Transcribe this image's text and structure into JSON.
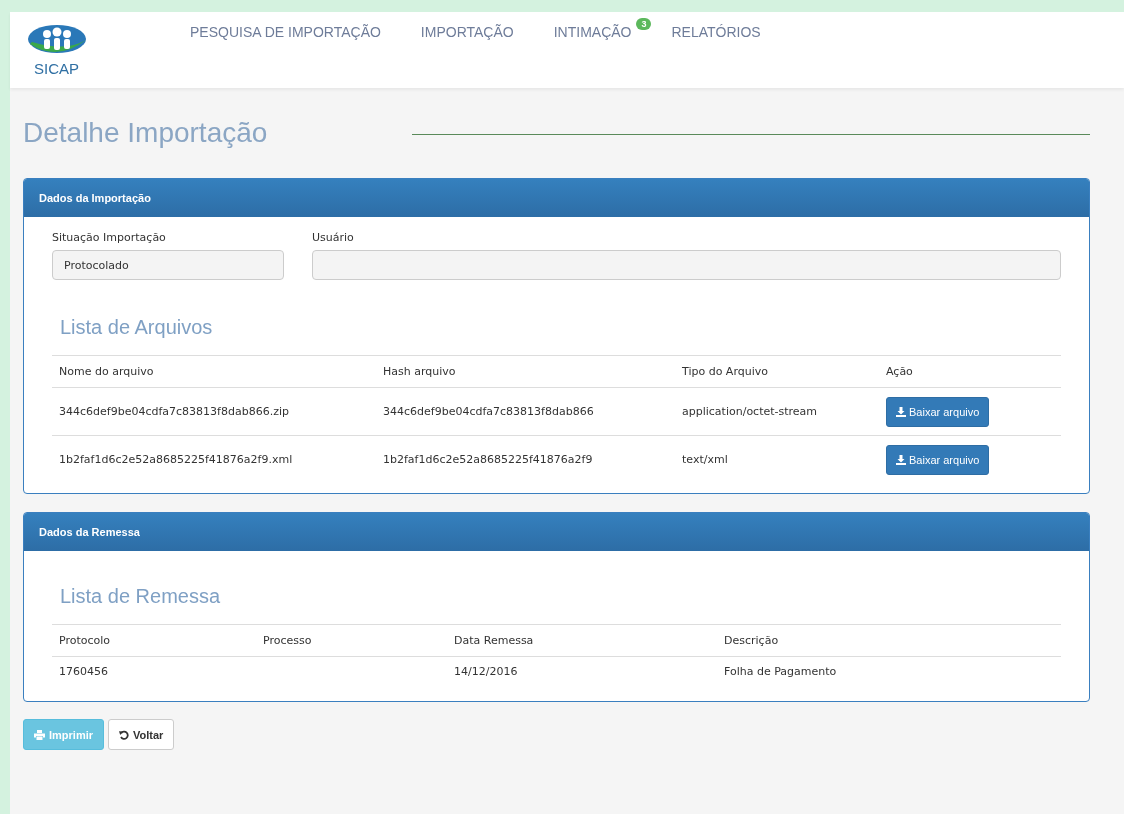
{
  "logo": {
    "text": "SICAP"
  },
  "nav": [
    {
      "label": "PESQUISA DE IMPORTAÇÃO"
    },
    {
      "label": "IMPORTAÇÃO"
    },
    {
      "label": "INTIMAÇÃO",
      "badge": "3"
    },
    {
      "label": "RELATÓRIOS"
    }
  ],
  "page_title": "Detalhe Importação",
  "import_panel": {
    "title": "Dados da Importação",
    "fields": [
      {
        "label": "Situação Importação",
        "value": "Protocolado"
      },
      {
        "label": "Usuário"
      }
    ],
    "list_title": "Lista de Arquivos",
    "columns": [
      "Nome do arquivo",
      "Hash arquivo",
      "Tipo do Arquivo",
      "Ação"
    ],
    "rows": [
      {
        "name": "344c6def9be04cdfa7c83813f8dab866.zip",
        "hash": "344c6def9be04cdfa7c83813f8dab866",
        "type": "application/octet-stream",
        "action": "Baixar arquivo"
      },
      {
        "name": "1b2faf1d6c2e52a8685225f41876a2f9.xml",
        "hash": "1b2faf1d6c2e52a8685225f41876a2f9",
        "type": "text/xml",
        "action": "Baixar arquivo"
      }
    ]
  },
  "remessa_panel": {
    "title": "Dados da Remessa",
    "list_title": "Lista de Remessa",
    "columns": [
      "Protocolo",
      "Processo",
      "Data Remessa",
      "Descrição"
    ],
    "rows": [
      [
        "1760456",
        null,
        "14/12/2016",
        "Folha de Pagamento"
      ]
    ]
  },
  "buttons": [
    {
      "label": "Imprimir",
      "kind": "print"
    },
    {
      "label": "Voltar",
      "kind": "back"
    }
  ]
}
